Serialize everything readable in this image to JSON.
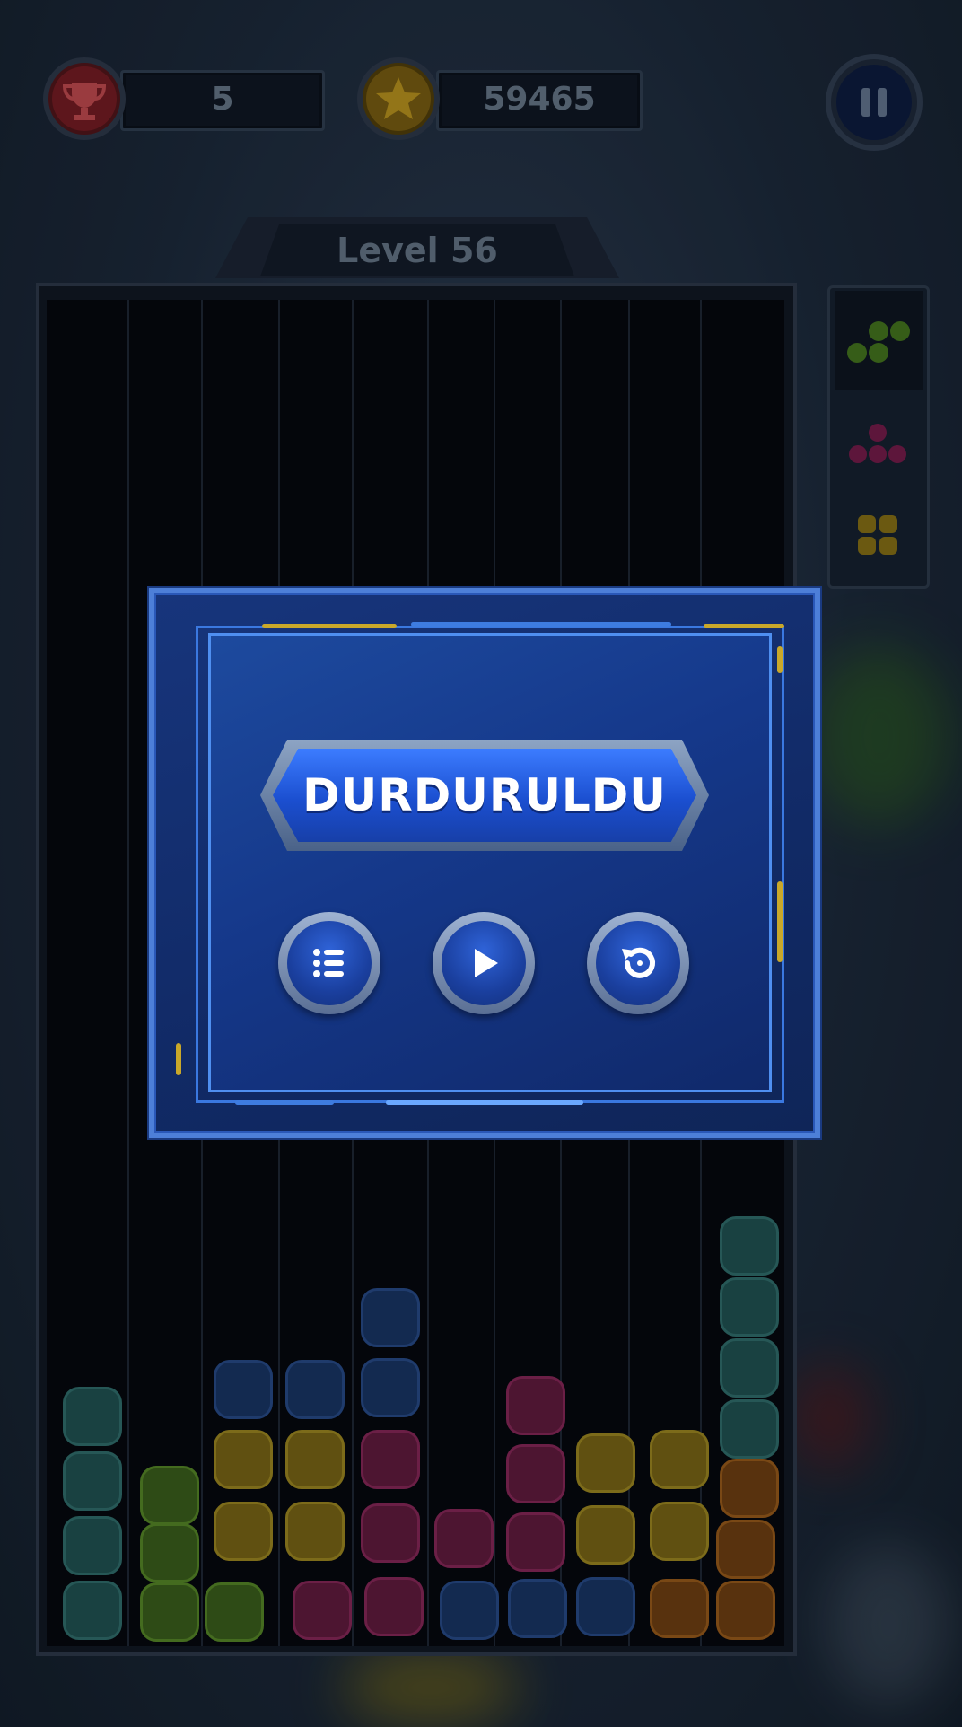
{
  "hud": {
    "trophy_count": "5",
    "star_score": "59465",
    "pause_icon": "pause-icon",
    "trophy_icon": "trophy-icon",
    "star_icon": "star-icon"
  },
  "level": {
    "label": "Level 56"
  },
  "next_pieces": [
    "green",
    "magenta",
    "yellow"
  ],
  "pause_dialog": {
    "title": "DURDURULDU",
    "buttons": [
      "menu-list-icon",
      "play-icon",
      "restart-icon"
    ]
  },
  "colors": {
    "teal": "#1f5a58",
    "green": "#3f6b1c",
    "yellow": "#8a7418",
    "blue": "#1a3566",
    "magenta": "#6a1a44",
    "orange": "#7a4812",
    "dialog_blue": "#1b4fd0"
  }
}
